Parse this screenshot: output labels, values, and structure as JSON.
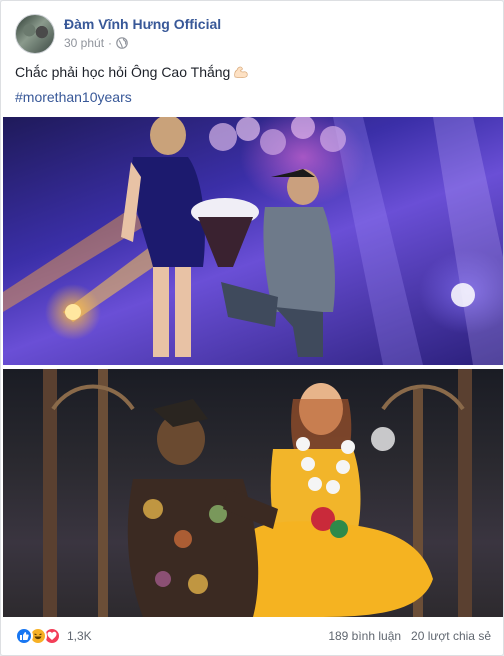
{
  "post": {
    "page_name": "Đàm Vĩnh Hưng Official",
    "time": "30 phút",
    "separator": "·",
    "privacy_icon": "globe-icon",
    "text": "Chắc phải học hỏi Ông Cao Thắng",
    "text_emoji": "flexed-biceps-icon",
    "hashtag": "#morethan10years"
  },
  "footer": {
    "reactions": [
      "like-icon",
      "haha-icon",
      "love-icon"
    ],
    "reaction_count": "1,3K",
    "comments": "189 bình luận",
    "shares": "20 lượt chia sẻ"
  },
  "colors": {
    "link": "#385898",
    "like": "#1877f2",
    "haha": "#f7b125",
    "love": "#f33e58"
  }
}
